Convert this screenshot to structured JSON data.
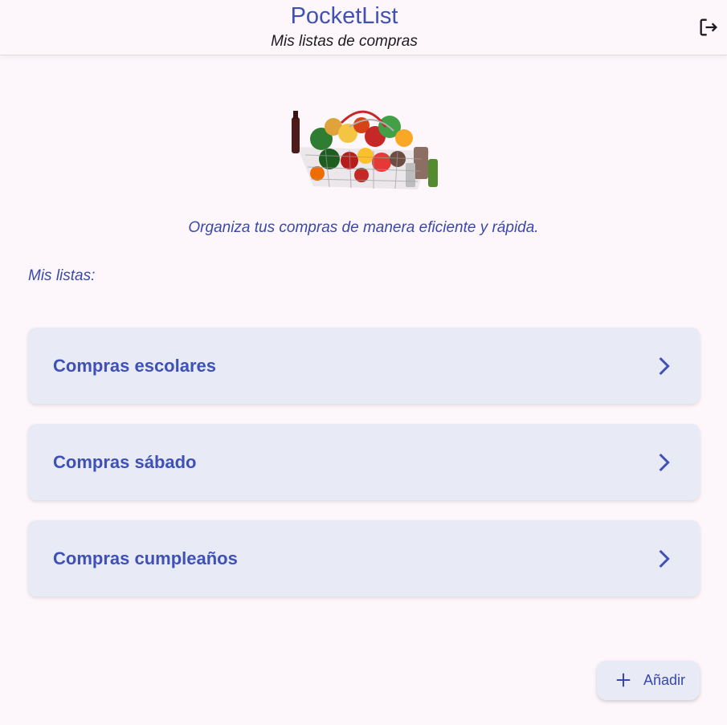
{
  "header": {
    "title": "PocketList",
    "subtitle": "Mis listas de compras",
    "logout_icon": "logout-icon"
  },
  "hero": {
    "image": "grocery-basket-illustration",
    "tagline": "Organiza tus compras de manera eficiente y rápida."
  },
  "lists": {
    "section_label": "Mis listas:",
    "items": [
      {
        "label": "Compras escolares",
        "icon": "chevron-right-icon"
      },
      {
        "label": "Compras sábado",
        "icon": "chevron-right-icon"
      },
      {
        "label": "Compras cumpleaños",
        "icon": "chevron-right-icon"
      }
    ]
  },
  "fab": {
    "label": "Añadir",
    "icon": "plus-icon"
  },
  "colors": {
    "primary": "#3f51b5",
    "card_bg": "#e8eaf6",
    "page_bg": "#fdf7fc"
  }
}
